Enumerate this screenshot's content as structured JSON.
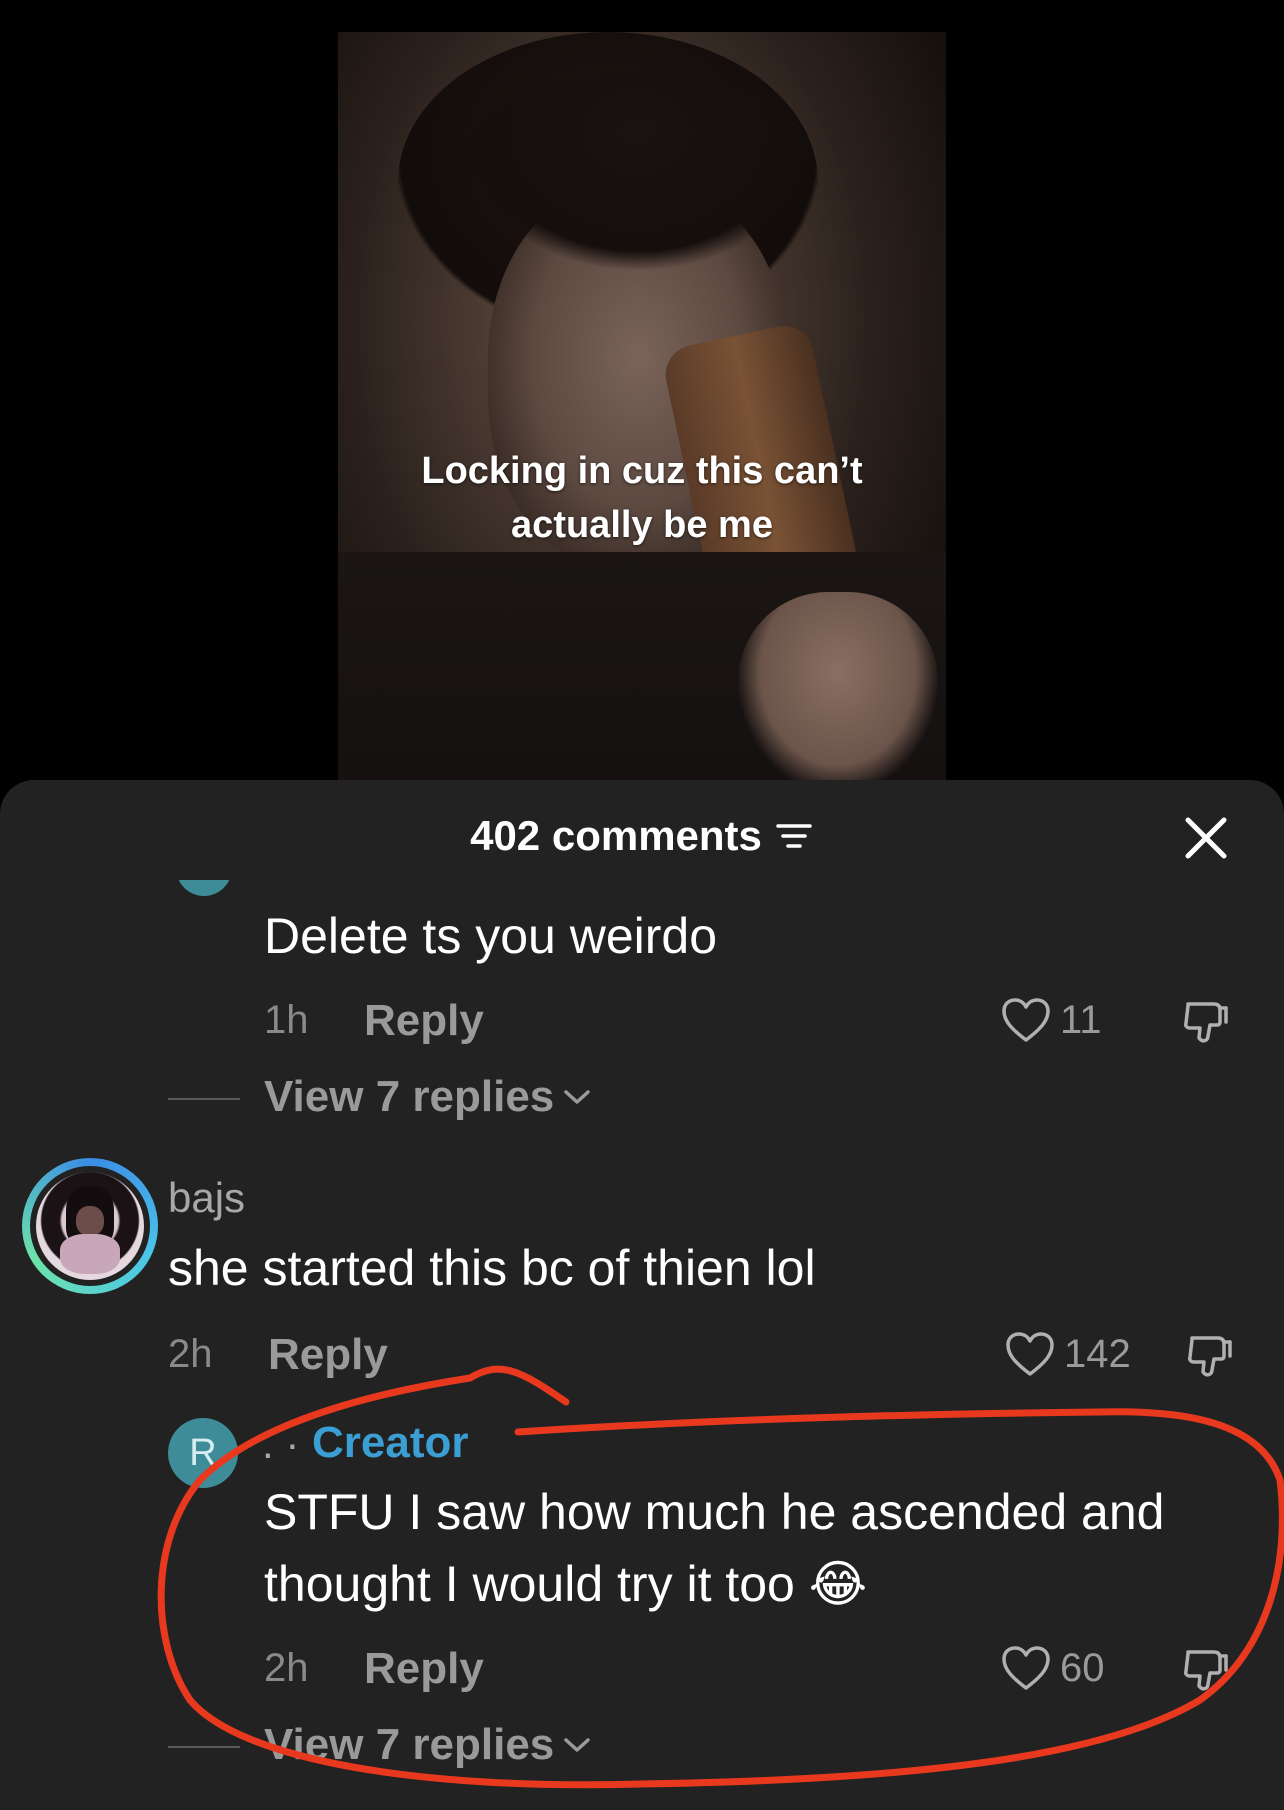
{
  "video": {
    "caption_line1": "Locking in cuz this can’t",
    "caption_line2": "actually be me"
  },
  "header": {
    "title": "402 comments",
    "filter_icon": "filter-icon",
    "close_icon": "close-icon"
  },
  "comments": [
    {
      "text": "Delete ts you weirdo",
      "time": "1h",
      "reply_label": "Reply",
      "likes": "11",
      "view_replies": "View 7 replies"
    },
    {
      "username": "bajs",
      "text": "she started this bc of thien lol",
      "time": "2h",
      "reply_label": "Reply",
      "likes": "142"
    },
    {
      "avatar_letter": "R",
      "prefix": ". ·",
      "badge": "Creator",
      "text_line1": "STFU I saw how much he ascended and",
      "text_line2": "thought I would try it too 😂",
      "time": "2h",
      "reply_label": "Reply",
      "likes": "60",
      "view_replies": "View 7 replies"
    }
  ],
  "colors": {
    "sheet_bg": "#222222",
    "creator_accent": "#3c9fd4",
    "annotation_red": "#e8391e"
  }
}
